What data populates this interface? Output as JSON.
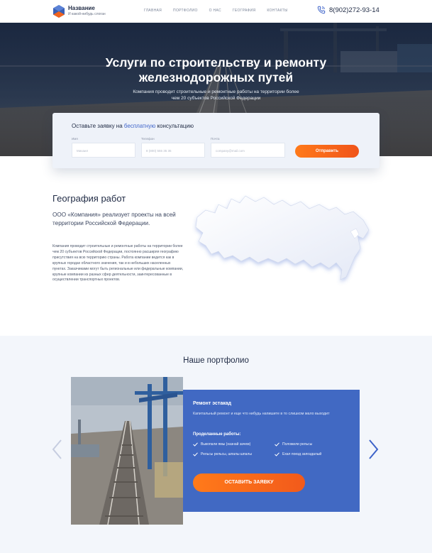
{
  "header": {
    "logo_title": "Название",
    "logo_subtitle": "И какой-нибудь слоган",
    "nav": [
      "ГЛАВНАЯ",
      "ПОРТФОЛИО",
      "О НАС",
      "ГЕОГРАФИЯ",
      "КОНТАКТЫ"
    ],
    "phone": "8(902)272-93-14"
  },
  "hero": {
    "title_line1": "Услуги по строительству и ремонту",
    "title_line2": "железнодорожных путей",
    "subtitle": "Компания проводит строительные и ремонтные работы на территории более чем 20 субъектов Российской Федерации"
  },
  "form": {
    "title_prefix": "Оставьте заявку на ",
    "title_highlight": "бесплатную",
    "title_suffix": " консультацию",
    "name_label": "Имя",
    "name_placeholder": "Михаил",
    "phone_label": "Телефон",
    "phone_placeholder": "8 (800) 555 35 35",
    "email_label": "Почта",
    "email_placeholder": "company@mail.com",
    "submit": "Отправить"
  },
  "geo": {
    "title": "География работ",
    "lead": "ООО «Компания» реализует проекты на всей территории Российской Федерации.",
    "body": "Компания проводит строительные и ремонтные работы на территории более чем 20 субъектов Российской Федерации, постоянно расширяя географию присутствия на всю территорию страны. Работа компании ведется как в крупных городах областного значения, так и в небольших населенных пунктах. Заказчиками могут быть региональные или федеральные компании, крупные компании из разных сфер деятельности, заинтересованные в осуществлении транспортных проектов."
  },
  "portfolio": {
    "title": "Наше портфолио",
    "card_title": "Ремонт эстакад",
    "card_desc": "Капитальный ремонт и еще что нибудь напишите в то слишком мало выходит",
    "works_title": "Проделанные работы:",
    "works": [
      "Выкопали ямы (назнай зачем)",
      "Положили рельсы",
      "Рельсы рельсы, шпалы шпалы",
      "Ехал поезд запоздалый"
    ],
    "cta": "ОСТАВИТЬ ЗАЯВКУ"
  },
  "colors": {
    "accent_orange": "#f0541a",
    "brand_blue": "#4169c3",
    "dark_text": "#1f2a44"
  }
}
